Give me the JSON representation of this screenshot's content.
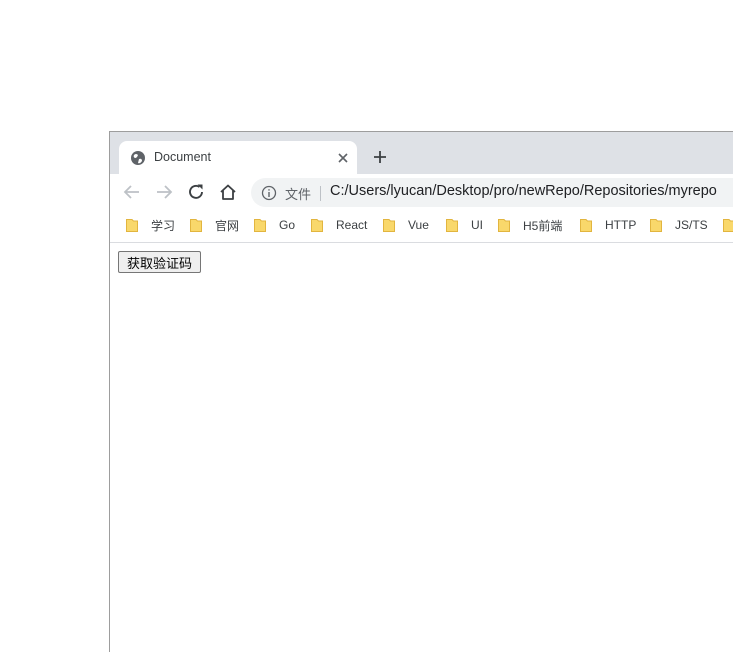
{
  "tab": {
    "title": "Document"
  },
  "omnibox": {
    "security_label": "文件",
    "url": "C:/Users/lyucan/Desktop/pro/newRepo/Repositories/myrepo"
  },
  "bookmarks": [
    {
      "label": "学习"
    },
    {
      "label": "官网"
    },
    {
      "label": "Go"
    },
    {
      "label": "React"
    },
    {
      "label": "Vue"
    },
    {
      "label": "UI"
    },
    {
      "label": "H5前端"
    },
    {
      "label": "HTTP"
    },
    {
      "label": "JS/TS"
    },
    {
      "label": ""
    }
  ],
  "page": {
    "button_label": "获取验证码"
  },
  "icons": {
    "favicon": "globe-icon",
    "close": "close-icon",
    "new_tab": "plus-icon",
    "back": "arrow-left-icon",
    "forward": "arrow-right-icon",
    "reload": "reload-icon",
    "home": "home-icon",
    "info": "info-icon",
    "bookmark": "folder-icon"
  },
  "colors": {
    "tabstrip": "#dee1e6",
    "omnibox": "#f1f3f4",
    "folder": "#f9d86b"
  }
}
